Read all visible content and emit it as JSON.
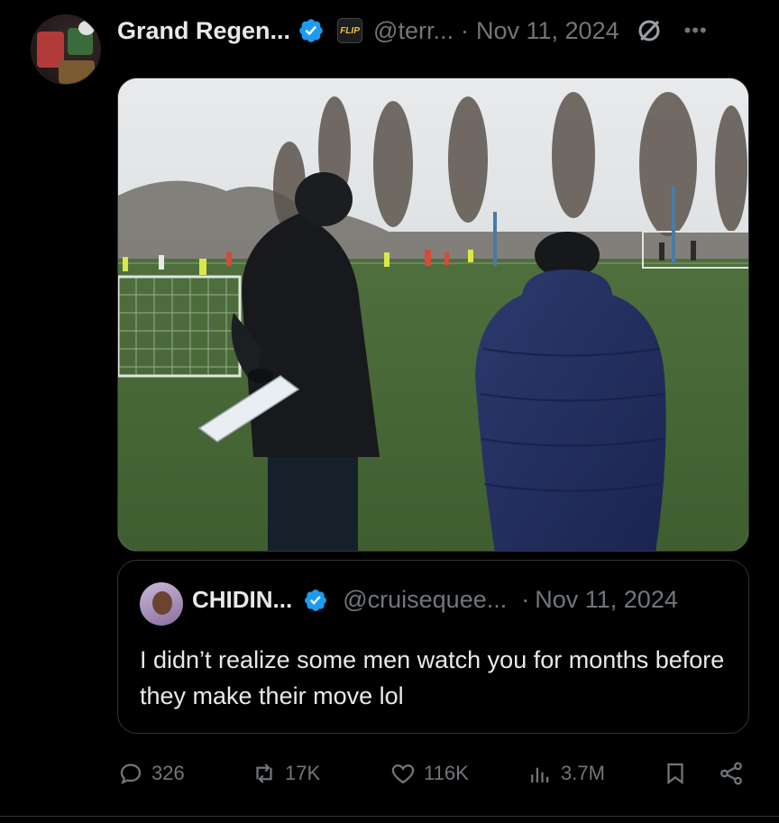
{
  "post": {
    "author_name": "Grand Regen...",
    "author_handle": "@terr...",
    "separator": "·",
    "date": "Nov 11, 2024",
    "badge_text": "FLIP",
    "more_label": "•••"
  },
  "quote": {
    "author_name": "CHIDIN...",
    "author_handle": "@cruisequee...",
    "separator": "·",
    "date": "Nov 11, 2024",
    "text": "I didn’t realize some men watch you for months before they make their move lol"
  },
  "actions": {
    "replies": "326",
    "reposts": "17K",
    "likes": "116K",
    "views": "3.7M"
  },
  "colors": {
    "background": "#000000",
    "text": "#e7e9ea",
    "secondary": "#71767b",
    "verified": "#1d9bf0",
    "border": "#2f3336"
  },
  "icons": {
    "verified": "verified-badge-icon",
    "grok": "grok-icon",
    "reply": "reply-icon",
    "repost": "repost-icon",
    "like": "heart-icon",
    "views": "views-icon",
    "bookmark": "bookmark-icon",
    "share": "share-icon"
  }
}
